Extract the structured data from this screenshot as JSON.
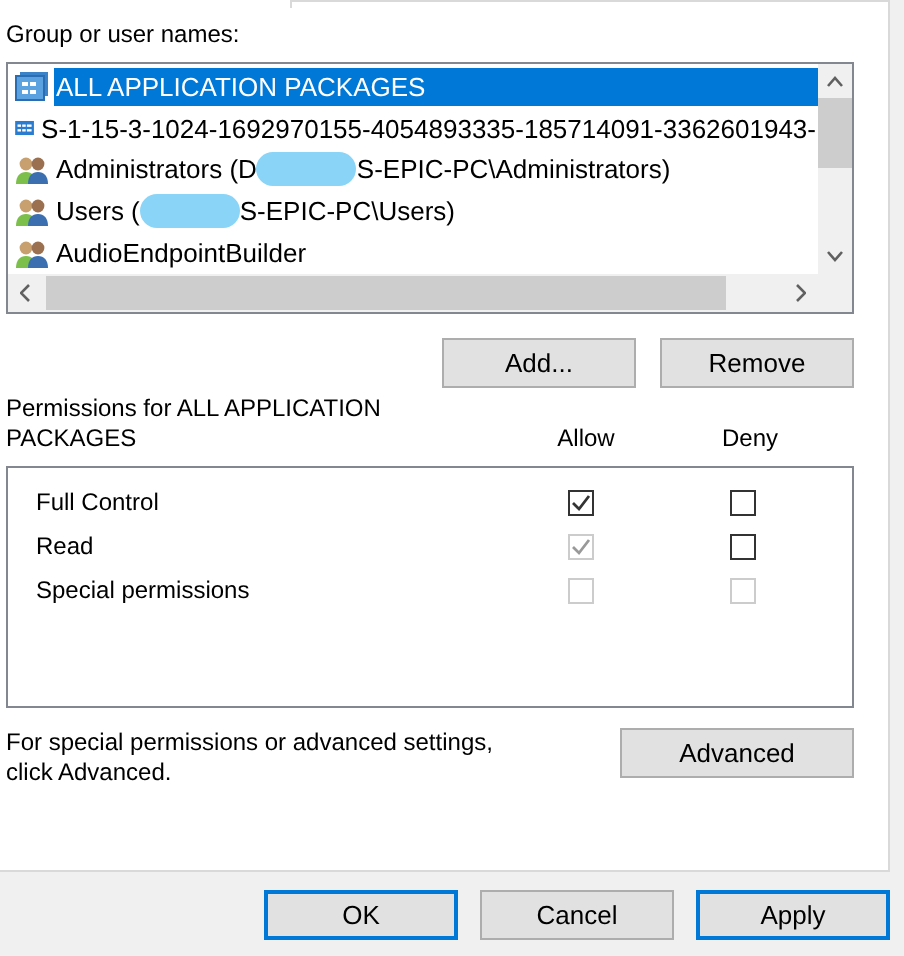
{
  "users_label": "Group or user names:",
  "users": [
    {
      "kind": "package",
      "name": "ALL APPLICATION PACKAGES",
      "selected": true
    },
    {
      "kind": "capability",
      "name": "S-1-15-3-1024-1692970155-4054893335-185714091-3362601943-",
      "selected": false
    },
    {
      "kind": "group",
      "name": "Administrators (D",
      "redacted": true,
      "suffix": "S-EPIC-PC\\Administrators)",
      "selected": false
    },
    {
      "kind": "group",
      "name": "Users (",
      "redacted": true,
      "suffix": "S-EPIC-PC\\Users)",
      "selected": false
    },
    {
      "kind": "group",
      "name": "AudioEndpointBuilder",
      "selected": false
    }
  ],
  "user_buttons": [
    "Add...",
    "Remove"
  ],
  "permissions": {
    "title": "Permissions for ALL APPLICATION PACKAGES",
    "columns": [
      "Allow",
      "Deny"
    ],
    "rows": [
      {
        "name": "Full Control",
        "allow": {
          "checked": true,
          "disabled": false
        },
        "deny": {
          "checked": false,
          "disabled": false
        }
      },
      {
        "name": "Read",
        "allow": {
          "checked": true,
          "disabled": true
        },
        "deny": {
          "checked": false,
          "disabled": false
        }
      },
      {
        "name": "Special permissions",
        "allow": {
          "checked": false,
          "disabled": true
        },
        "deny": {
          "checked": false,
          "disabled": true
        }
      }
    ]
  },
  "advanced": {
    "text": "For special permissions or advanced settings, click Advanced.",
    "button": "Advanced"
  },
  "buttons": [
    {
      "label": "OK",
      "default": true
    },
    {
      "label": "Cancel",
      "default": false
    },
    {
      "label": "Apply",
      "default": true
    }
  ]
}
